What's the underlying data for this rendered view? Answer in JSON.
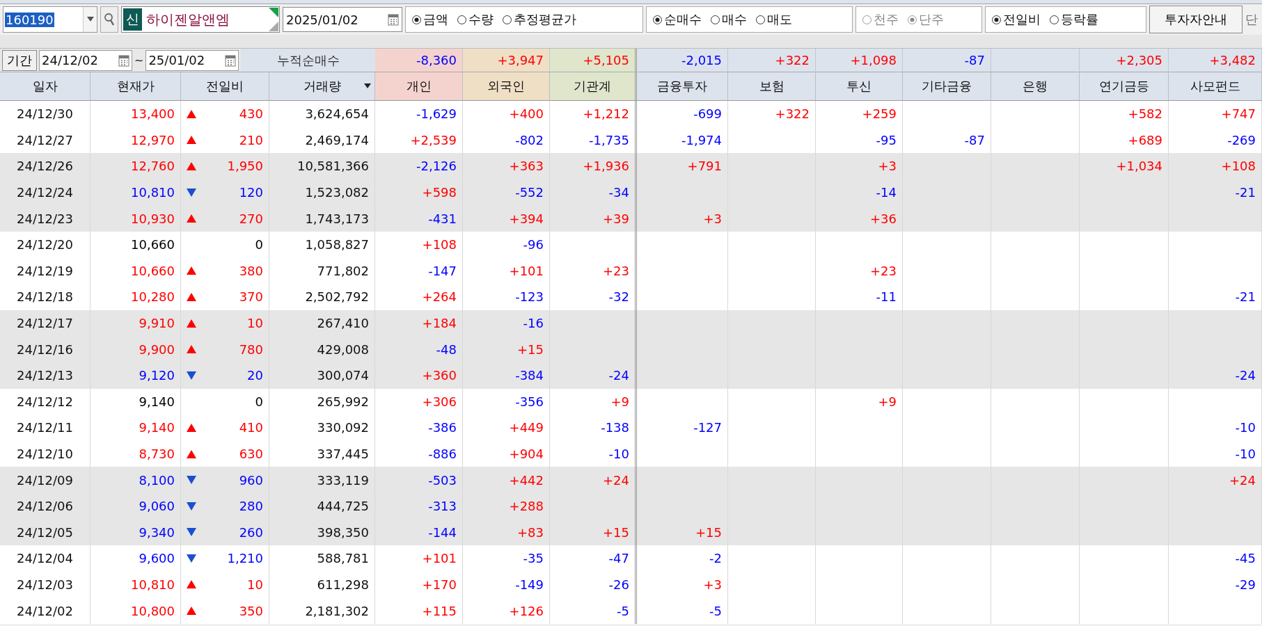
{
  "toolbar": {
    "code": "160190",
    "badge": "신",
    "name": "하이젠알앤엠",
    "date": "2025/01/02",
    "radio_groups": [
      {
        "disabled": false,
        "options": [
          {
            "label": "금액",
            "selected": true
          },
          {
            "label": "수량",
            "selected": false
          },
          {
            "label": "추정평균가",
            "selected": false
          }
        ]
      },
      {
        "disabled": false,
        "options": [
          {
            "label": "순매수",
            "selected": true
          },
          {
            "label": "매수",
            "selected": false
          },
          {
            "label": "매도",
            "selected": false
          }
        ]
      },
      {
        "disabled": true,
        "options": [
          {
            "label": "천주",
            "selected": false
          },
          {
            "label": "단주",
            "selected": true
          }
        ]
      },
      {
        "disabled": false,
        "options": [
          {
            "label": "전일비",
            "selected": true
          },
          {
            "label": "등락률",
            "selected": false
          }
        ]
      }
    ],
    "guide_button": "투자자안내",
    "cut_label": "단"
  },
  "period": {
    "button": "기간",
    "from": "24/12/02",
    "separator": "~",
    "to": "25/01/02",
    "label": "누적순매수",
    "totals": {
      "individual": "-8,360",
      "foreign": "+3,947",
      "institution": "+5,105",
      "financial_investment": "-2,015",
      "insurance": "+322",
      "investment_trust": "+1,098",
      "other_finance": "-87",
      "pension": "+2,305",
      "private_fund": "+3,482"
    }
  },
  "table": {
    "columns": [
      {
        "label": "일자",
        "color": "#dce3ed"
      },
      {
        "label": "현재가",
        "color": "#dce3ed"
      },
      {
        "label": "전일비",
        "color": "#dce3ed"
      },
      {
        "label": "거래량",
        "color": "#dce3ed",
        "dropdown": true
      },
      {
        "label": "개인",
        "color": "#f4d3cf"
      },
      {
        "label": "외국인",
        "color": "#efdfc5"
      },
      {
        "label": "기관계",
        "color": "#dfe6cc"
      },
      {
        "label": "금융투자",
        "color": "#dce3ed"
      },
      {
        "label": "보험",
        "color": "#dce3ed"
      },
      {
        "label": "투신",
        "color": "#dce3ed"
      },
      {
        "label": "기타금융",
        "color": "#dce3ed"
      },
      {
        "label": "은행",
        "color": "#dce3ed"
      },
      {
        "label": "연기금등",
        "color": "#dce3ed"
      },
      {
        "label": "사모펀드",
        "color": "#dce3ed"
      }
    ],
    "rows": [
      {
        "date": "24/12/30",
        "price": "13,400",
        "rise": true,
        "fall": false,
        "change": "430",
        "volume": "3,624,654",
        "values": {
          "individual": "-1,629",
          "foreign": "+400",
          "institution": "+1,212",
          "financial_investment": "-699",
          "insurance": "+322",
          "investment_trust": "+259",
          "pension": "+582",
          "private_fund": "+747"
        }
      },
      {
        "date": "24/12/27",
        "price": "12,970",
        "rise": true,
        "fall": false,
        "change": "210",
        "volume": "2,469,174",
        "values": {
          "individual": "+2,539",
          "foreign": "-802",
          "institution": "-1,735",
          "financial_investment": "-1,974",
          "investment_trust": "-95",
          "other_finance": "-87",
          "pension": "+689",
          "private_fund": "-269"
        }
      },
      {
        "date": "24/12/26",
        "price": "12,760",
        "rise": true,
        "fall": false,
        "change": "1,950",
        "volume": "10,581,366",
        "values": {
          "individual": "-2,126",
          "foreign": "+363",
          "institution": "+1,936",
          "financial_investment": "+791",
          "investment_trust": "+3",
          "pension": "+1,034",
          "private_fund": "+108"
        }
      },
      {
        "date": "24/12/24",
        "price": "10,810",
        "rise": false,
        "fall": true,
        "change": "120",
        "volume": "1,523,082",
        "values": {
          "individual": "+598",
          "foreign": "-552",
          "institution": "-34",
          "investment_trust": "-14",
          "private_fund": "-21"
        }
      },
      {
        "date": "24/12/23",
        "price": "10,930",
        "rise": true,
        "fall": false,
        "change": "270",
        "volume": "1,743,173",
        "values": {
          "individual": "-431",
          "foreign": "+394",
          "institution": "+39",
          "financial_investment": "+3",
          "investment_trust": "+36"
        }
      },
      {
        "date": "24/12/20",
        "price": "10,660",
        "rise": false,
        "fall": false,
        "change": "0",
        "volume": "1,058,827",
        "values": {
          "individual": "+108",
          "foreign": "-96"
        }
      },
      {
        "date": "24/12/19",
        "price": "10,660",
        "rise": true,
        "fall": false,
        "change": "380",
        "volume": "771,802",
        "values": {
          "individual": "-147",
          "foreign": "+101",
          "institution": "+23",
          "investment_trust": "+23"
        }
      },
      {
        "date": "24/12/18",
        "price": "10,280",
        "rise": true,
        "fall": false,
        "change": "370",
        "volume": "2,502,792",
        "values": {
          "individual": "+264",
          "foreign": "-123",
          "institution": "-32",
          "investment_trust": "-11",
          "private_fund": "-21"
        }
      },
      {
        "date": "24/12/17",
        "price": "9,910",
        "rise": true,
        "fall": false,
        "change": "10",
        "volume": "267,410",
        "values": {
          "individual": "+184",
          "foreign": "-16"
        }
      },
      {
        "date": "24/12/16",
        "price": "9,900",
        "rise": true,
        "fall": false,
        "change": "780",
        "volume": "429,008",
        "values": {
          "individual": "-48",
          "foreign": "+15"
        }
      },
      {
        "date": "24/12/13",
        "price": "9,120",
        "rise": false,
        "fall": true,
        "change": "20",
        "volume": "300,074",
        "values": {
          "individual": "+360",
          "foreign": "-384",
          "institution": "-24",
          "private_fund": "-24"
        }
      },
      {
        "date": "24/12/12",
        "price": "9,140",
        "rise": false,
        "fall": false,
        "change": "0",
        "volume": "265,992",
        "values": {
          "individual": "+306",
          "foreign": "-356",
          "institution": "+9",
          "investment_trust": "+9"
        }
      },
      {
        "date": "24/12/11",
        "price": "9,140",
        "rise": true,
        "fall": false,
        "change": "410",
        "volume": "330,092",
        "values": {
          "individual": "-386",
          "foreign": "+449",
          "institution": "-138",
          "financial_investment": "-127",
          "private_fund": "-10"
        }
      },
      {
        "date": "24/12/10",
        "price": "8,730",
        "rise": true,
        "fall": false,
        "change": "630",
        "volume": "337,445",
        "values": {
          "individual": "-886",
          "foreign": "+904",
          "institution": "-10",
          "private_fund": "-10"
        }
      },
      {
        "date": "24/12/09",
        "price": "8,100",
        "rise": false,
        "fall": true,
        "change": "960",
        "volume": "333,119",
        "values": {
          "individual": "-503",
          "foreign": "+442",
          "institution": "+24",
          "private_fund": "+24"
        }
      },
      {
        "date": "24/12/06",
        "price": "9,060",
        "rise": false,
        "fall": true,
        "change": "280",
        "volume": "444,725",
        "values": {
          "individual": "-313",
          "foreign": "+288"
        }
      },
      {
        "date": "24/12/05",
        "price": "9,340",
        "rise": false,
        "fall": true,
        "change": "260",
        "volume": "398,350",
        "values": {
          "individual": "-144",
          "foreign": "+83",
          "institution": "+15",
          "financial_investment": "+15"
        }
      },
      {
        "date": "24/12/04",
        "price": "9,600",
        "rise": false,
        "fall": true,
        "change": "1,210",
        "volume": "588,781",
        "values": {
          "individual": "+101",
          "foreign": "-35",
          "institution": "-47",
          "financial_investment": "-2",
          "private_fund": "-45"
        }
      },
      {
        "date": "24/12/03",
        "price": "10,810",
        "rise": true,
        "fall": false,
        "change": "10",
        "volume": "611,298",
        "values": {
          "individual": "+170",
          "foreign": "-149",
          "institution": "-26",
          "financial_investment": "+3",
          "private_fund": "-29"
        }
      },
      {
        "date": "24/12/02",
        "price": "10,800",
        "rise": true,
        "fall": false,
        "change": "350",
        "volume": "2,181,302",
        "values": {
          "individual": "+115",
          "foreign": "+126",
          "institution": "-5",
          "financial_investment": "-5"
        }
      }
    ]
  }
}
